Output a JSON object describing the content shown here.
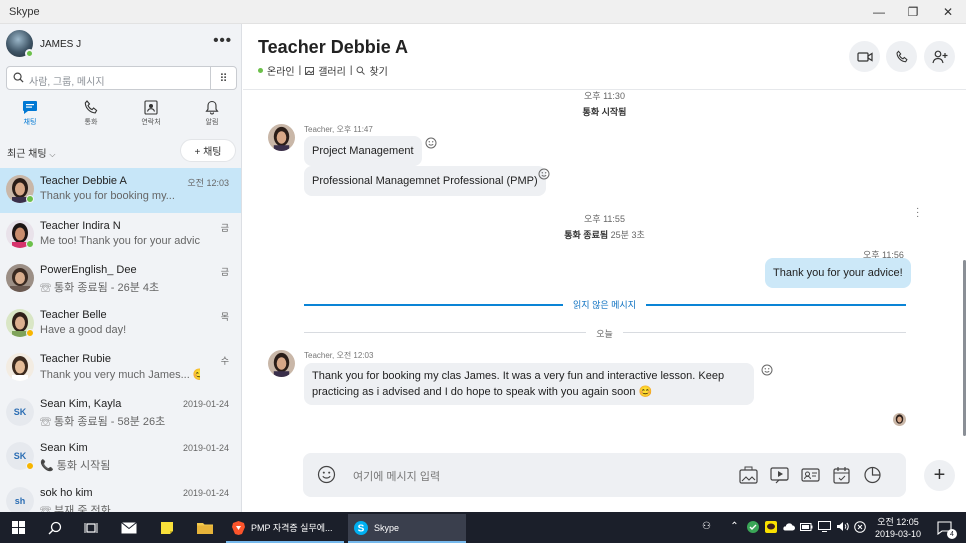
{
  "window": {
    "title": "Skype",
    "minimize": "—",
    "restore": "❐",
    "close": "✕"
  },
  "profile": {
    "name": "JAMES J",
    "more": "•••"
  },
  "search": {
    "placeholder": "사람, 그룹, 메시지",
    "dialpad": "⠿"
  },
  "nav": [
    {
      "label": "채팅",
      "icon": "chat-icon",
      "active": true
    },
    {
      "label": "통화",
      "icon": "phone-icon",
      "active": false
    },
    {
      "label": "연락처",
      "icon": "contacts-icon",
      "active": false
    },
    {
      "label": "알림",
      "icon": "bell-icon",
      "active": false
    }
  ],
  "recent": {
    "label": "최근 채팅",
    "new_chat": "+ 채팅"
  },
  "contacts": [
    {
      "name": "Teacher Debbie A",
      "message": "Thank you for booking my...",
      "time": "오전 12:03",
      "status": "#6cc04a",
      "active": true
    },
    {
      "name": "Teacher Indira N",
      "message": "Me too! Thank you for your advice!",
      "time": "금",
      "status": "#6cc04a"
    },
    {
      "name": "PowerEnglish_ Dee",
      "message": "☏ 통화 종료됨 - 26분 4초",
      "time": "금",
      "status": ""
    },
    {
      "name": "Teacher Belle",
      "message": "Have a good day!",
      "time": "목",
      "status": "#f7b500"
    },
    {
      "name": "Teacher Rubie",
      "message": "Thank you very much James... 😊",
      "time": "수",
      "status": ""
    },
    {
      "name": "Sean Kim, Kayla",
      "message": "☏ 통화 종료됨 - 58분 26초",
      "time": "2019-01-24",
      "initials": "SK",
      "status": ""
    },
    {
      "name": "Sean Kim",
      "message": "📞 통화 시작됨",
      "time": "2019-01-24",
      "initials": "SK",
      "status": "#f7b500"
    },
    {
      "name": "sok ho kim",
      "message": "☏ 부재 중 전화",
      "time": "2019-01-24",
      "initials": "sh",
      "status": ""
    }
  ],
  "chat": {
    "title": "Teacher Debbie A",
    "status": "온라인",
    "gallery": "갤러리",
    "find": "찾기",
    "sep": "|"
  },
  "messages": {
    "sys1_time": "오후 11:30",
    "sys1_text": "통화 시작됨",
    "m1_meta": "Teacher, 오후 11:47",
    "m1_text": "Project Management",
    "m2_text": "Professional Managemnet Professional (PMP)",
    "sys2_time": "오후 11:55",
    "sys2_text": "통화 종료됨",
    "sys2_duration": "25분 3초",
    "out_time": "오후 11:56",
    "out_text": "Thank you for your advice!",
    "unread": "읽지 않은 메시지",
    "today": "오늘",
    "m3_meta": "Teacher, 오전 12:03",
    "m3_line1": "Thank you for booking my clas James. It was a very fun and interactive lesson. Keep",
    "m3_line2": "practicing as i advised and I do hope to speak with you again soon 😊"
  },
  "composer": {
    "placeholder": "여기에 메시지 입력",
    "plus": "+"
  },
  "taskbar": {
    "app1": "PMP 자격증 실무에...",
    "app2": "Skype",
    "time": "오전 12:05",
    "date": "2019-03-10",
    "notif_count": "4"
  },
  "colors": {
    "accent": "#0078d4",
    "online": "#6cc04a",
    "away": "#f7b500",
    "active_row": "#c7e6f8"
  }
}
